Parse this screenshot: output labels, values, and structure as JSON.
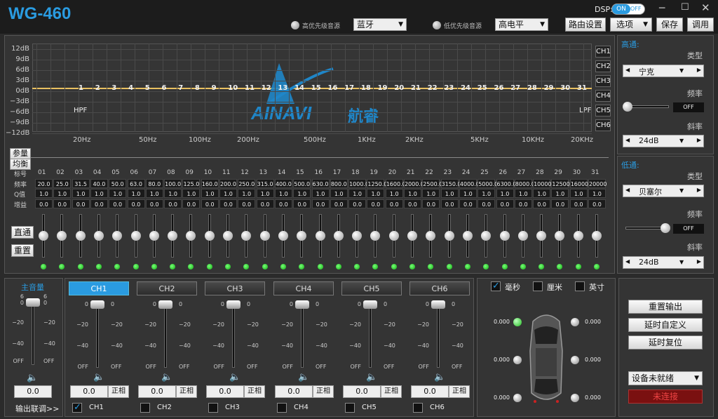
{
  "app": {
    "title": "WG-460"
  },
  "titlebar": {
    "dsp_label": "DSP:",
    "dsp_on": "ON",
    "dsp_off": "OFF",
    "high_priority_label": "高优先级音源",
    "high_priority_value": "蓝牙",
    "low_priority_label": "低优先级音源",
    "low_priority_value": "高电平",
    "route_btn": "路由设置",
    "options_btn": "选项",
    "save_btn": "保存",
    "load_btn": "调用"
  },
  "graph": {
    "y_labels": [
      "12dB",
      "9dB",
      "6dB",
      "3dB",
      "0dB",
      "−3dB",
      "−6dB",
      "−9dB",
      "−12dB"
    ],
    "x_labels": [
      "20Hz",
      "50Hz",
      "100Hz",
      "200Hz",
      "500Hz",
      "1KHz",
      "2KHz",
      "5KHz",
      "10KHz",
      "20KHz"
    ],
    "hpf": "HPF",
    "lpf": "LPF",
    "channels": [
      "CH1",
      "CH2",
      "CH3",
      "CH4",
      "CH5",
      "CH6"
    ],
    "logo_text": "AINAVI",
    "logo_cn": "航睿",
    "band_numbers": [
      "1",
      "2",
      "3",
      "4",
      "5",
      "6",
      "7",
      "8",
      "9",
      "10",
      "11",
      "12",
      "13",
      "14",
      "15",
      "16",
      "17",
      "18",
      "19",
      "20",
      "21",
      "22",
      "23",
      "24",
      "25",
      "26",
      "27",
      "28",
      "29",
      "30",
      "31"
    ],
    "line_color": "#e8c060"
  },
  "eq": {
    "tab_param": "参量",
    "tab_eq": "均衡",
    "row_labels": [
      "标号",
      "频率",
      "Q值",
      "增益"
    ],
    "ids": [
      "01",
      "02",
      "03",
      "04",
      "05",
      "06",
      "07",
      "08",
      "09",
      "10",
      "11",
      "12",
      "13",
      "14",
      "15",
      "16",
      "17",
      "18",
      "19",
      "20",
      "21",
      "22",
      "23",
      "24",
      "25",
      "26",
      "27",
      "28",
      "29",
      "30",
      "31"
    ],
    "freqs": [
      "20.0",
      "25.0",
      "31.5",
      "40.0",
      "50.0",
      "63.0",
      "80.0",
      "100.0",
      "125.0",
      "160.0",
      "200.0",
      "250.0",
      "315.0",
      "400.0",
      "500.0",
      "630.0",
      "800.0",
      "1000.0",
      "1250.0",
      "1600.0",
      "2000.0",
      "2500.0",
      "3150.0",
      "4000.0",
      "5000.0",
      "6300.0",
      "8000.0",
      "10000",
      "12500",
      "16000",
      "20000"
    ],
    "q": [
      "1.0",
      "1.0",
      "1.0",
      "1.0",
      "1.0",
      "1.0",
      "1.0",
      "1.0",
      "1.0",
      "1.0",
      "1.0",
      "1.0",
      "1.0",
      "1.0",
      "1.0",
      "1.0",
      "1.0",
      "1.0",
      "1.0",
      "1.0",
      "1.0",
      "1.0",
      "1.0",
      "1.0",
      "1.0",
      "1.0",
      "1.0",
      "1.0",
      "1.0",
      "1.0",
      "1.0"
    ],
    "gain": [
      "0.0",
      "0.0",
      "0.0",
      "0.0",
      "0.0",
      "0.0",
      "0.0",
      "0.0",
      "0.0",
      "0.0",
      "0.0",
      "0.0",
      "0.0",
      "0.0",
      "0.0",
      "0.0",
      "0.0",
      "0.0",
      "0.0",
      "0.0",
      "0.0",
      "0.0",
      "0.0",
      "0.0",
      "0.0",
      "0.0",
      "0.0",
      "0.0",
      "0.0",
      "0.0",
      "0.0"
    ],
    "bypass_btn": "直通",
    "reset_btn": "重置"
  },
  "highpass": {
    "title": "高通:",
    "type_label": "类型",
    "type_value": "宁克",
    "freq_label": "频率",
    "freq_value": "OFF",
    "slope_label": "斜率",
    "slope_value": "24dB"
  },
  "lowpass": {
    "title": "低通:",
    "type_label": "类型",
    "type_value": "贝塞尔",
    "freq_label": "频率",
    "freq_value": "OFF",
    "slope_label": "斜率",
    "slope_value": "24dB"
  },
  "master": {
    "title": "主音量",
    "scale": [
      "6",
      "0",
      "−20",
      "−40",
      "OFF"
    ],
    "value": "0.0",
    "link_label": "输出联调>>"
  },
  "channels": {
    "names": [
      "CH1",
      "CH2",
      "CH3",
      "CH4",
      "CH5",
      "CH6"
    ],
    "scale": [
      "0",
      "−20",
      "−40",
      "OFF"
    ],
    "values": [
      "0.0",
      "0.0",
      "0.0",
      "0.0",
      "0.0",
      "0.0"
    ],
    "phase_label": "正相",
    "link_checks": [
      "CH1",
      "CH2",
      "CH3",
      "CH4",
      "CH5",
      "CH6"
    ],
    "link_checked": [
      true,
      false,
      false,
      false,
      false,
      false
    ]
  },
  "delay": {
    "unit_ms": "毫秒",
    "unit_cm": "厘米",
    "unit_inch": "英寸",
    "speaker_values": [
      "0.000",
      "0.000",
      "0.000",
      "0.000",
      "0.000",
      "0.000"
    ]
  },
  "actions": {
    "reset_output": "重置输出",
    "delay_custom": "延时自定义",
    "delay_reset": "延时复位",
    "device_status": "设备未就绪",
    "connect_status": "未连接"
  }
}
